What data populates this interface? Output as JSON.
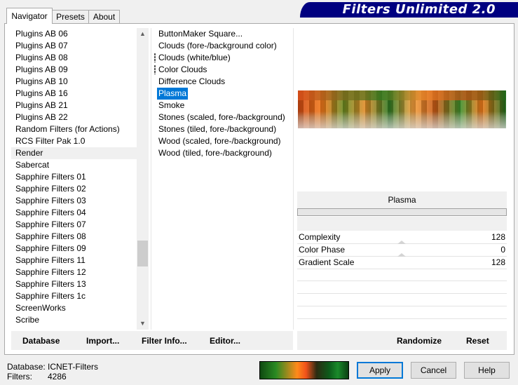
{
  "tabs": [
    "Navigator",
    "Presets",
    "About"
  ],
  "banner_title": "Filters Unlimited 2.0",
  "categories": [
    "Plugins AB 06",
    "Plugins AB 07",
    "Plugins AB 08",
    "Plugins AB 09",
    "Plugins AB 10",
    "Plugins AB 16",
    "Plugins AB 21",
    "Plugins AB 22",
    "Random Filters (for Actions)",
    "RCS Filter Pak 1.0",
    "Render",
    "Sabercat",
    "Sapphire Filters 01",
    "Sapphire Filters 02",
    "Sapphire Filters 03",
    "Sapphire Filters 04",
    "Sapphire Filters 07",
    "Sapphire Filters 08",
    "Sapphire Filters 09",
    "Sapphire Filters 11",
    "Sapphire Filters 12",
    "Sapphire Filters 13",
    "Sapphire Filters 1c",
    "ScreenWorks",
    "Scribe"
  ],
  "selected_category": "Render",
  "filters": [
    "ButtonMaker Square...",
    "Clouds (fore-/background color)",
    "Clouds (white/blue)",
    "Color Clouds",
    "Difference Clouds",
    "Plasma",
    "Smoke",
    "Stones (scaled, fore-/background)",
    "Stones (tiled, fore-/background)",
    "Wood (scaled, fore-/background)",
    "Wood (tiled, fore-/background)"
  ],
  "selected_filter": "Plasma",
  "filter_title": "Plasma",
  "params": [
    {
      "label": "Complexity",
      "value": "128"
    },
    {
      "label": "Color Phase",
      "value": "0"
    },
    {
      "label": "Gradient Scale",
      "value": "128"
    }
  ],
  "left_buttons": {
    "database": "Database",
    "import": "Import...",
    "filter_info": "Filter Info...",
    "editor": "Editor..."
  },
  "right_buttons": {
    "randomize": "Randomize",
    "reset": "Reset"
  },
  "status": {
    "database_label": "Database:",
    "database_value": "ICNET-Filters",
    "filters_label": "Filters:",
    "filters_value": "4286"
  },
  "dialog_buttons": {
    "apply": "Apply",
    "cancel": "Cancel",
    "help": "Help"
  },
  "icons": {
    "scroll_up": "chevron-up-icon",
    "scroll_down": "chevron-down-icon"
  },
  "colors": {
    "selection": "#0078d7",
    "banner": "#000080"
  }
}
